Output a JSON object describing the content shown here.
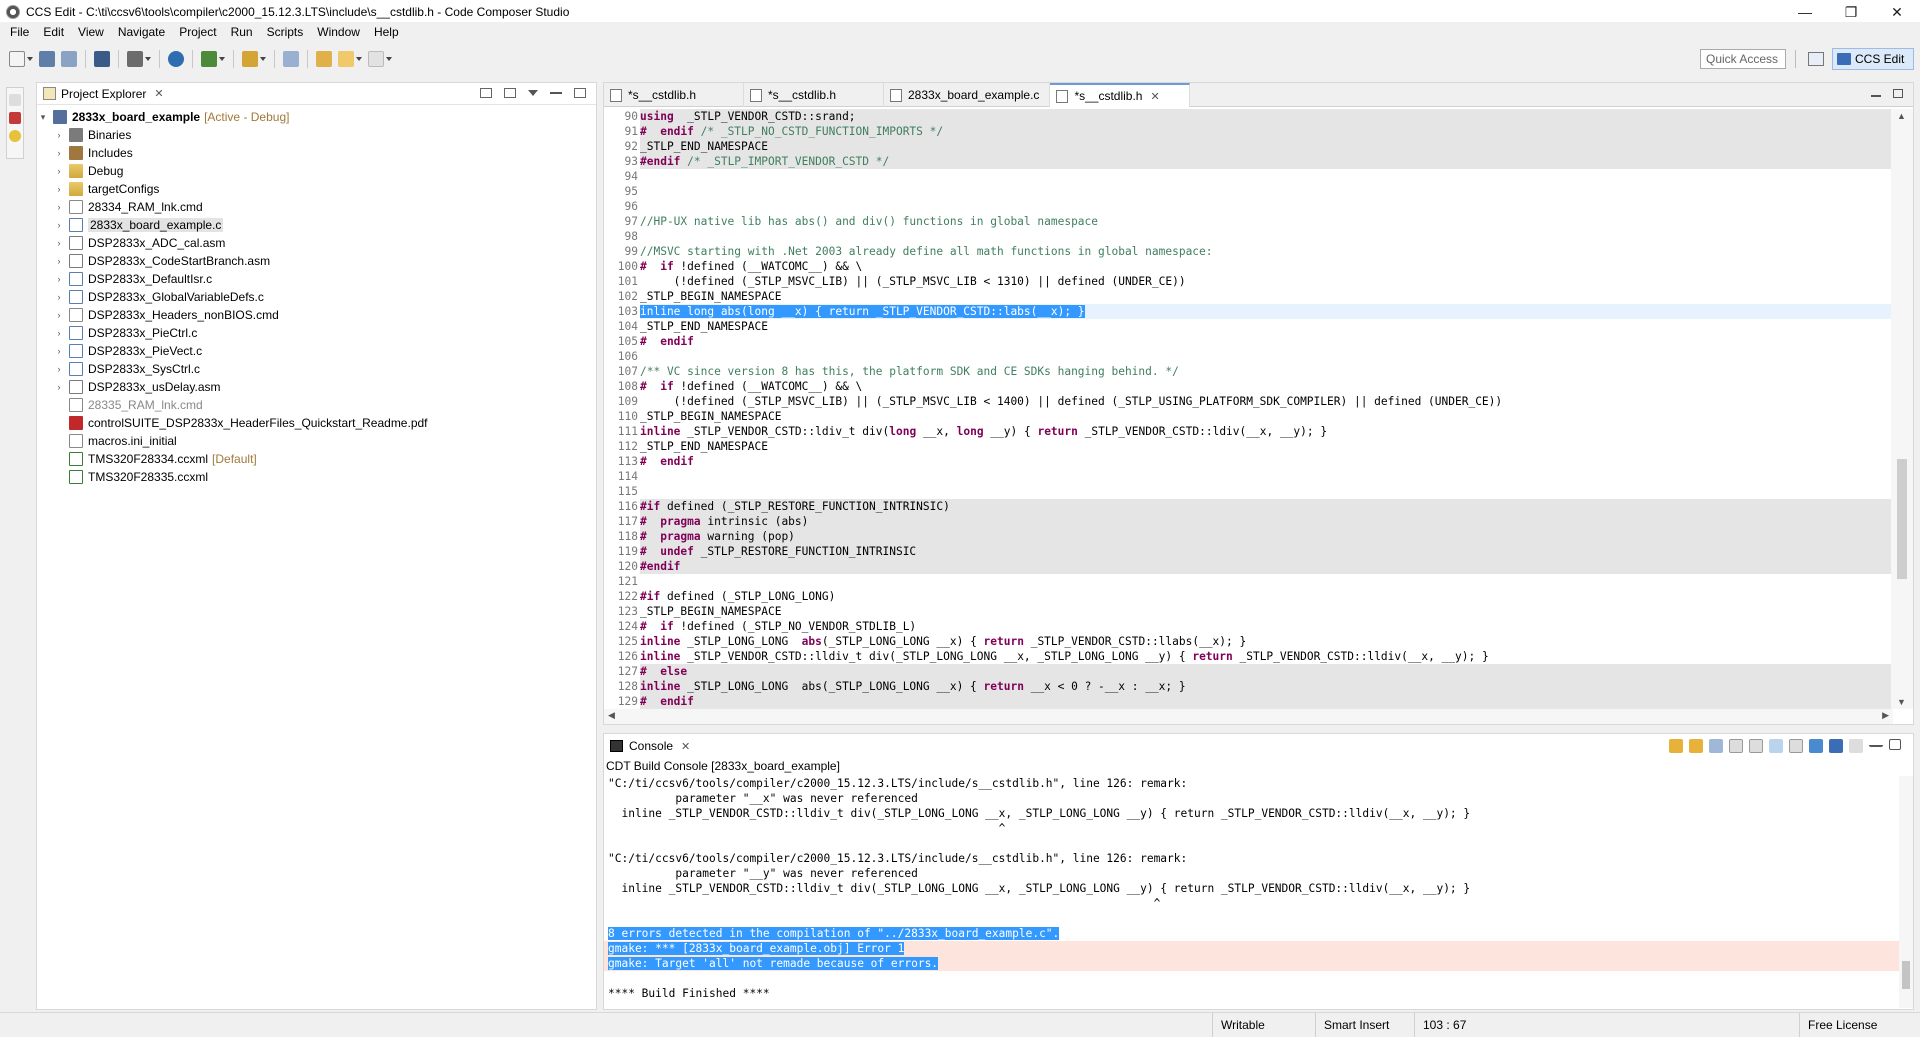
{
  "window": {
    "title": "CCS Edit - C:\\ti\\ccsv6\\tools\\compiler\\c2000_15.12.3.LTS\\include\\s__cstdlib.h - Code Composer Studio",
    "minimize": "—",
    "maximize": "❐",
    "close": "✕"
  },
  "menu": [
    "File",
    "Edit",
    "View",
    "Navigate",
    "Project",
    "Run",
    "Scripts",
    "Window",
    "Help"
  ],
  "toolbar": {
    "quick_access": "Quick Access",
    "perspective": "CCS Edit"
  },
  "explorer": {
    "tab_label": "Project Explorer",
    "project": {
      "name": "2833x_board_example",
      "status": "[Active - Debug]"
    },
    "items": [
      {
        "label": "Binaries",
        "icon": "binaries-icon",
        "expandable": true
      },
      {
        "label": "Includes",
        "icon": "includes-icon",
        "expandable": true
      },
      {
        "label": "Debug",
        "icon": "folder-icon",
        "expandable": true
      },
      {
        "label": "targetConfigs",
        "icon": "folder-icon",
        "expandable": true
      },
      {
        "label": "28334_RAM_lnk.cmd",
        "icon": "file-icon",
        "expandable": true
      },
      {
        "label": "2833x_board_example.c",
        "icon": "c-file-icon",
        "expandable": true,
        "selected": true
      },
      {
        "label": "DSP2833x_ADC_cal.asm",
        "icon": "asm-file-icon",
        "expandable": true
      },
      {
        "label": "DSP2833x_CodeStartBranch.asm",
        "icon": "asm-file-icon",
        "expandable": true
      },
      {
        "label": "DSP2833x_DefaultIsr.c",
        "icon": "c-file-icon",
        "expandable": true
      },
      {
        "label": "DSP2833x_GlobalVariableDefs.c",
        "icon": "c-file-icon",
        "expandable": true
      },
      {
        "label": "DSP2833x_Headers_nonBIOS.cmd",
        "icon": "file-icon",
        "expandable": true
      },
      {
        "label": "DSP2833x_PieCtrl.c",
        "icon": "c-file-icon",
        "expandable": true
      },
      {
        "label": "DSP2833x_PieVect.c",
        "icon": "c-file-icon",
        "expandable": true
      },
      {
        "label": "DSP2833x_SysCtrl.c",
        "icon": "c-file-icon",
        "expandable": true
      },
      {
        "label": "DSP2833x_usDelay.asm",
        "icon": "asm-file-icon",
        "expandable": true
      },
      {
        "label": "28335_RAM_lnk.cmd",
        "icon": "file-icon",
        "expandable": false,
        "grayed": true
      },
      {
        "label": "controlSUITE_DSP2833x_HeaderFiles_Quickstart_Readme.pdf",
        "icon": "pdf-icon",
        "expandable": false
      },
      {
        "label": "macros.ini_initial",
        "icon": "file-icon",
        "expandable": false
      },
      {
        "label": "TMS320F28334.ccxml",
        "icon": "xml-file-icon",
        "expandable": false,
        "suffix": "[Default]"
      },
      {
        "label": "TMS320F28335.ccxml",
        "icon": "xml-file-icon",
        "expandable": false
      }
    ]
  },
  "editor": {
    "tabs": [
      {
        "label": "*s__cstdlib.h",
        "active": false
      },
      {
        "label": "*s__cstdlib.h",
        "active": false
      },
      {
        "label": "2833x_board_example.c",
        "active": false
      },
      {
        "label": "*s__cstdlib.h",
        "active": true
      }
    ],
    "lines": [
      {
        "n": "90",
        "shade": true,
        "parts": [
          [
            "kw",
            "using"
          ],
          [
            "",
            "  _STLP_VENDOR_CSTD::srand;"
          ]
        ]
      },
      {
        "n": "91",
        "shade": true,
        "parts": [
          [
            "kw",
            "#  endif"
          ],
          [
            "cm",
            " /* _STLP_NO_CSTD_FUNCTION_IMPORTS */"
          ]
        ]
      },
      {
        "n": "92",
        "shade": true,
        "parts": [
          [
            "",
            "_STLP_END_NAMESPACE"
          ]
        ]
      },
      {
        "n": "93",
        "shade": true,
        "parts": [
          [
            "kw",
            "#endif"
          ],
          [
            "cm",
            " /* _STLP_IMPORT_VENDOR_CSTD */"
          ]
        ]
      },
      {
        "n": "94",
        "parts": []
      },
      {
        "n": "95",
        "parts": []
      },
      {
        "n": "96",
        "parts": []
      },
      {
        "n": "97",
        "parts": [
          [
            "cm",
            "//HP-UX native lib has abs() and div() functions in global namespace"
          ]
        ]
      },
      {
        "n": "98",
        "parts": []
      },
      {
        "n": "99",
        "parts": [
          [
            "cm",
            "//MSVC starting with .Net 2003 already define all math functions in global namespace:"
          ]
        ]
      },
      {
        "n": "100",
        "parts": [
          [
            "kw",
            "#  if"
          ],
          [
            "",
            " !defined (__WATCOMC__) && \\"
          ]
        ]
      },
      {
        "n": "101",
        "parts": [
          [
            "",
            "     (!defined (_STLP_MSVC_LIB) || (_STLP_MSVC_LIB < 1310) || defined (UNDER_CE))"
          ]
        ]
      },
      {
        "n": "102",
        "parts": [
          [
            "",
            "_STLP_BEGIN_NAMESPACE"
          ]
        ]
      },
      {
        "n": "103",
        "cur": true,
        "parts": [
          [
            "hl",
            "inline long abs(long __x) { return _STLP_VENDOR_CSTD::labs(__x); }"
          ]
        ]
      },
      {
        "n": "104",
        "parts": [
          [
            "",
            "_STLP_END_NAMESPACE"
          ]
        ]
      },
      {
        "n": "105",
        "parts": [
          [
            "kw",
            "#  endif"
          ]
        ]
      },
      {
        "n": "106",
        "parts": []
      },
      {
        "n": "107",
        "parts": [
          [
            "cm",
            "/** VC since version 8 has this, the platform SDK and CE SDKs hanging behind. */"
          ]
        ]
      },
      {
        "n": "108",
        "parts": [
          [
            "kw",
            "#  if"
          ],
          [
            "",
            " !defined (__WATCOMC__) && \\"
          ]
        ]
      },
      {
        "n": "109",
        "parts": [
          [
            "",
            "     (!defined (_STLP_MSVC_LIB) || (_STLP_MSVC_LIB < 1400) || defined (_STLP_USING_PLATFORM_SDK_COMPILER) || defined (UNDER_CE))"
          ]
        ]
      },
      {
        "n": "110",
        "parts": [
          [
            "",
            "_STLP_BEGIN_NAMESPACE"
          ]
        ]
      },
      {
        "n": "111",
        "parts": [
          [
            "kw",
            "inline"
          ],
          [
            "",
            " _STLP_VENDOR_CSTD::ldiv_t div("
          ],
          [
            "kw",
            "long"
          ],
          [
            "",
            " __x, "
          ],
          [
            "kw",
            "long"
          ],
          [
            "",
            " __y) { "
          ],
          [
            "kw",
            "return"
          ],
          [
            "",
            " _STLP_VENDOR_CSTD::ldiv(__x, __y); }"
          ]
        ]
      },
      {
        "n": "112",
        "parts": [
          [
            "",
            "_STLP_END_NAMESPACE"
          ]
        ]
      },
      {
        "n": "113",
        "parts": [
          [
            "kw",
            "#  endif"
          ]
        ]
      },
      {
        "n": "114",
        "parts": []
      },
      {
        "n": "115",
        "parts": []
      },
      {
        "n": "116",
        "shade": true,
        "parts": [
          [
            "kw",
            "#if"
          ],
          [
            "",
            " defined (_STLP_RESTORE_FUNCTION_INTRINSIC)"
          ]
        ]
      },
      {
        "n": "117",
        "shade": true,
        "parts": [
          [
            "kw",
            "#  pragma"
          ],
          [
            "",
            " intrinsic (abs)"
          ]
        ]
      },
      {
        "n": "118",
        "shade": true,
        "parts": [
          [
            "kw",
            "#  pragma"
          ],
          [
            "",
            " warning (pop)"
          ]
        ]
      },
      {
        "n": "119",
        "shade": true,
        "parts": [
          [
            "kw",
            "#  undef"
          ],
          [
            "",
            " _STLP_RESTORE_FUNCTION_INTRINSIC"
          ]
        ]
      },
      {
        "n": "120",
        "shade": true,
        "parts": [
          [
            "kw",
            "#endif"
          ]
        ]
      },
      {
        "n": "121",
        "parts": []
      },
      {
        "n": "122",
        "parts": [
          [
            "kw",
            "#if"
          ],
          [
            "",
            " defined (_STLP_LONG_LONG)"
          ]
        ]
      },
      {
        "n": "123",
        "parts": [
          [
            "",
            "_STLP_BEGIN_NAMESPACE"
          ]
        ]
      },
      {
        "n": "124",
        "parts": [
          [
            "kw",
            "#  if"
          ],
          [
            "",
            " !defined (_STLP_NO_VENDOR_STDLIB_L)"
          ]
        ]
      },
      {
        "n": "125",
        "parts": [
          [
            "kw",
            "inline"
          ],
          [
            "",
            " _STLP_LONG_LONG  "
          ],
          [
            "kw",
            "abs"
          ],
          [
            "",
            "(_STLP_LONG_LONG __x) { "
          ],
          [
            "kw",
            "return"
          ],
          [
            "",
            " _STLP_VENDOR_CSTD::llabs(__x); }"
          ]
        ]
      },
      {
        "n": "126",
        "parts": [
          [
            "kw",
            "inline"
          ],
          [
            "",
            " _STLP_VENDOR_CSTD::lldiv_t div(_STLP_LONG_LONG __x, _STLP_LONG_LONG __y) { "
          ],
          [
            "kw",
            "return"
          ],
          [
            "",
            " _STLP_VENDOR_CSTD::lldiv(__x, __y); }"
          ]
        ]
      },
      {
        "n": "127",
        "shade": true,
        "parts": [
          [
            "kw",
            "#  else"
          ]
        ]
      },
      {
        "n": "128",
        "shade": true,
        "parts": [
          [
            "kw",
            "inline"
          ],
          [
            "",
            " _STLP_LONG_LONG  abs(_STLP_LONG_LONG __x) { "
          ],
          [
            "kw",
            "return"
          ],
          [
            "",
            " __x < 0 ? -__x : __x; }"
          ]
        ]
      },
      {
        "n": "129",
        "shade": true,
        "parts": [
          [
            "kw",
            "#  endif"
          ]
        ]
      }
    ]
  },
  "console": {
    "tab_label": "Console",
    "title": "CDT Build Console [2833x_board_example]",
    "lines": [
      {
        "text": "\"C:/ti/ccsv6/tools/compiler/c2000_15.12.3.LTS/include/s__cstdlib.h\", line 126: remark:"
      },
      {
        "text": "          parameter \"__x\" was never referenced"
      },
      {
        "text": "  inline _STLP_VENDOR_CSTD::lldiv_t div(_STLP_LONG_LONG __x, _STLP_LONG_LONG __y) { return _STLP_VENDOR_CSTD::lldiv(__x, __y); }"
      },
      {
        "text": "                                                          ^"
      },
      {
        "text": ""
      },
      {
        "text": "\"C:/ti/ccsv6/tools/compiler/c2000_15.12.3.LTS/include/s__cstdlib.h\", line 126: remark:"
      },
      {
        "text": "          parameter \"__y\" was never referenced"
      },
      {
        "text": "  inline _STLP_VENDOR_CSTD::lldiv_t div(_STLP_LONG_LONG __x, _STLP_LONG_LONG __y) { return _STLP_VENDOR_CSTD::lldiv(__x, __y); }"
      },
      {
        "text": "                                                                                 ^"
      },
      {
        "text": ""
      },
      {
        "text": "8 errors detected in the compilation of \"../2833x_board_example.c\".",
        "selected": true
      },
      {
        "text": "gmake: *** [2833x_board_example.obj] Error 1",
        "selected": true,
        "error": true
      },
      {
        "text": "gmake: Target 'all' not remade because of errors.",
        "selected": true,
        "error": true
      },
      {
        "text": ""
      },
      {
        "text": "**** Build Finished ****"
      }
    ]
  },
  "status": {
    "writable": "Writable",
    "insert_mode": "Smart Insert",
    "position": "103 : 67",
    "license": "Free License"
  }
}
